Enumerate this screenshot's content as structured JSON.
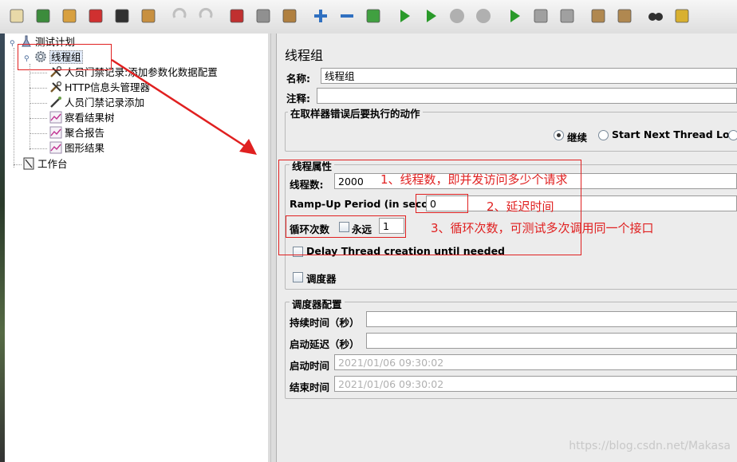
{
  "toolbar": {
    "buttons": [
      {
        "name": "new-icon",
        "color": "#e8d9a8"
      },
      {
        "name": "templates-icon",
        "color": "#3c8c3c"
      },
      {
        "name": "open-icon",
        "color": "#d8a040"
      },
      {
        "name": "close-file-icon",
        "color": "#d03030"
      },
      {
        "name": "save-icon",
        "color": "#303030"
      },
      {
        "name": "save-edit-icon",
        "color": "#c89040"
      },
      {
        "name": "undo-icon",
        "color": "#c0c0c0"
      },
      {
        "name": "redo-icon",
        "color": "#c0c0c0"
      },
      {
        "name": "cut-icon",
        "color": "#c03030"
      },
      {
        "name": "copy-icon",
        "color": "#909090"
      },
      {
        "name": "paste-icon",
        "color": "#b08040"
      },
      {
        "name": "expand-icon",
        "color": "#3070c0"
      },
      {
        "name": "collapse-icon",
        "color": "#3070c0"
      },
      {
        "name": "toggle-icon",
        "color": "#40a040"
      },
      {
        "name": "start-icon",
        "color": "#2a9a2a"
      },
      {
        "name": "start-no-pause-icon",
        "color": "#2a9a2a"
      },
      {
        "name": "stop-icon",
        "color": "#b0b0b0"
      },
      {
        "name": "shutdown-icon",
        "color": "#b0b0b0"
      },
      {
        "name": "remote-start-icon",
        "color": "#2a9a2a"
      },
      {
        "name": "remote-stop-icon",
        "color": "#a0a0a0"
      },
      {
        "name": "remote-shutdown-icon",
        "color": "#a0a0a0"
      },
      {
        "name": "clear-icon",
        "color": "#b08850"
      },
      {
        "name": "clear-all-icon",
        "color": "#b08850"
      },
      {
        "name": "search-icon",
        "color": "#303030"
      },
      {
        "name": "reset-search-icon",
        "color": "#d8b030"
      }
    ]
  },
  "tree": {
    "test_plan": "测试计划",
    "thread_group": "线程组",
    "children": [
      {
        "label": "人员门禁记录:添加参数化数据配置",
        "icon": "wrench-icon"
      },
      {
        "label": "HTTP信息头管理器",
        "icon": "wrench-icon"
      },
      {
        "label": "人员门禁记录添加",
        "icon": "pipette-icon"
      },
      {
        "label": "察看结果树",
        "icon": "graph-icon"
      },
      {
        "label": "聚合报告",
        "icon": "graph-icon"
      },
      {
        "label": "图形结果",
        "icon": "graph-icon"
      }
    ],
    "workbench": "工作台"
  },
  "panel": {
    "title": "线程组",
    "name_label": "名称:",
    "name_value": "线程组",
    "comment_label": "注释:",
    "comment_value": "",
    "error_group_title": "在取样器错误后要执行的动作",
    "error_options": [
      {
        "label": "继续",
        "selected": true
      },
      {
        "label": "Start Next Thread Loop",
        "selected": false
      }
    ],
    "thread_props_title": "线程属性",
    "threads_label": "线程数:",
    "threads_value": "2000",
    "rampup_label": "Ramp-Up Period (in seconds):",
    "rampup_value": "0",
    "loop_label": "循环次数",
    "forever_label": "永远",
    "loop_value": "1",
    "delay_label": "Delay Thread creation until needed",
    "scheduler_label": "调度器",
    "scheduler_config_title": "调度器配置",
    "duration_label": "持续时间（秒）",
    "duration_value": "",
    "startup_delay_label": "启动延迟（秒）",
    "startup_delay_value": "",
    "start_time_label": "启动时间",
    "start_time_value": "2021/01/06 09:30:02",
    "end_time_label": "结束时间",
    "end_time_value": "2021/01/06 09:30:02"
  },
  "annotations": {
    "note1": "1、线程数，即并发访问多少个请求",
    "note2": "2、延迟时间",
    "note3": "3、循环次数，可测试多次调用同一个接口",
    "color": "#e02020"
  },
  "watermark": "https://blog.csdn.net/Makasa"
}
